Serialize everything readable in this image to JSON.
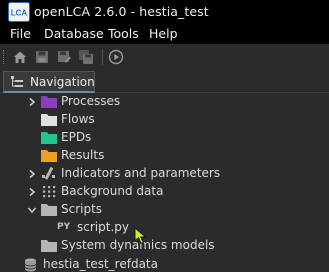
{
  "window": {
    "logo_text": "LCA",
    "title": "openLCA 2.6.0 - hestia_test"
  },
  "menu": {
    "items": [
      "File",
      "Database",
      "Tools",
      "Help"
    ]
  },
  "toolbar": {
    "icons": [
      "home-icon",
      "save-icon",
      "save-as-icon",
      "save-all-icon",
      "run-icon"
    ]
  },
  "navigation": {
    "tab_label": "Navigation",
    "tree": {
      "processes": "Processes",
      "flows": "Flows",
      "epds": "EPDs",
      "results": "Results",
      "indicators": "Indicators and parameters",
      "background": "Background data",
      "scripts": "Scripts",
      "script_file_badge": "PY",
      "script_file": "script.py",
      "system_dynamics": "System dynamics models",
      "database_ref": "hestia_test_refdata"
    }
  },
  "colors": {
    "processes_folder": "#8a3fbf",
    "flows_folder": "#e0e0e0",
    "epds_folder": "#22c58f",
    "results_folder": "#f0a020",
    "gray_folder": "#b5b5b5",
    "cursor": "#c8f020",
    "background": "#2b2b2b"
  }
}
